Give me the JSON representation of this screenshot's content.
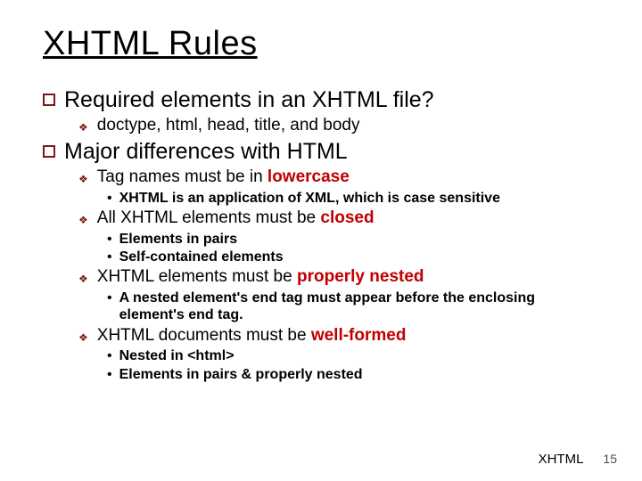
{
  "title": "XHTML Rules",
  "sections": [
    {
      "heading": "Required elements in an XHTML file?",
      "items": [
        {
          "text": "doctype, html, head, title, and body"
        }
      ]
    },
    {
      "heading": "Major differences with HTML",
      "items": [
        {
          "pre": "Tag names must be in ",
          "em": "lowercase",
          "sub": [
            "XHTML is an application of XML, which is case sensitive"
          ]
        },
        {
          "pre": "All XHTML elements must be ",
          "em": "closed",
          "sub": [
            "Elements in pairs",
            "Self-contained elements"
          ]
        },
        {
          "pre": "XHTML elements must be ",
          "em": "properly nested",
          "sub": [
            "A nested element's end tag must appear before the enclosing element's end tag."
          ]
        },
        {
          "pre": "XHTML documents must be ",
          "em": "well-formed",
          "sub": [
            "Nested in <html>",
            "Elements in pairs & properly nested"
          ]
        }
      ]
    }
  ],
  "footer": {
    "label": "XHTML",
    "page": "15"
  }
}
